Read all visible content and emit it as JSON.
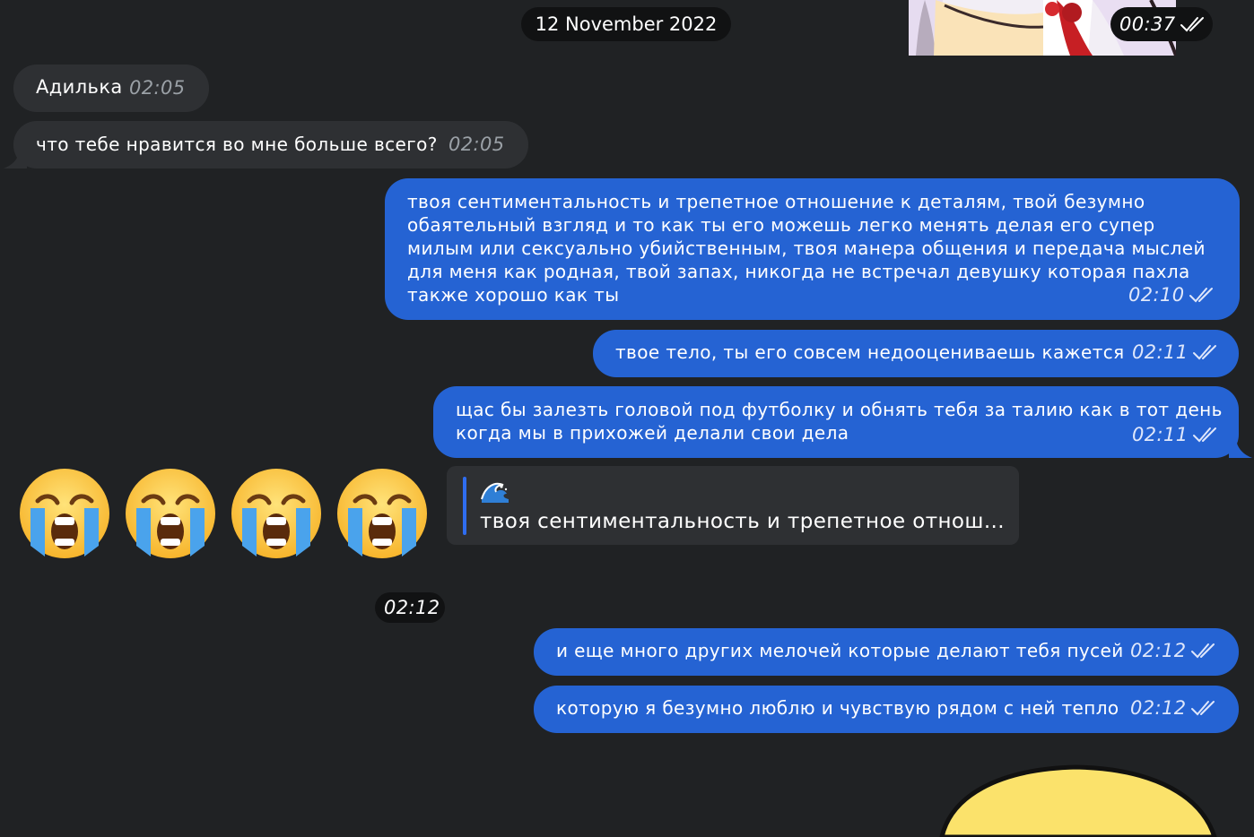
{
  "date_separator": "12 November 2022",
  "top_sticker_time": "00:37",
  "incoming": [
    {
      "text": "Адилька",
      "time": "02:05"
    },
    {
      "text": "что тебе нравится во мне больше всего?",
      "time": "02:05"
    }
  ],
  "outgoing": [
    {
      "lines": [
        "твоя сентиментальность и трепетное отношение к деталям, твой безумно",
        "обаятельный взгляд и то как ты его можешь легко менять делая его супер",
        "милым или сексуально убийственным, твоя манера общения и передача мыслей",
        "для меня как родная, твой запах, никогда не встречал девушку которая пахла",
        "также хорошо как ты"
      ],
      "time": "02:10"
    },
    {
      "lines": [
        "твое тело, ты его совсем недооцениваешь кажется"
      ],
      "time": "02:11"
    },
    {
      "lines": [
        "щас бы залезть головой под футболку и обнять тебя за талию как в тот день",
        "когда мы в прихожей делали свои дела"
      ],
      "time": "02:11"
    },
    {
      "lines": [
        "и еще много других мелочей которые делают тебя пусей"
      ],
      "time": "02:12"
    },
    {
      "lines": [
        "которую я безумно люблю и чувствую рядом с ней тепло"
      ],
      "time": "02:12"
    }
  ],
  "emoji_message": {
    "icons": [
      "loudly-crying-face-icon",
      "loudly-crying-face-icon",
      "loudly-crying-face-icon",
      "loudly-crying-face-icon"
    ],
    "time": "02:12",
    "reply": {
      "icon": "water-wave-icon",
      "quote": "твоя сентиментальность и трепетное отнош..."
    }
  },
  "colors": {
    "background": "#202224",
    "incoming_bubble": "#2e3033",
    "outgoing_bubble": "#2563d3",
    "pill": "#111213",
    "reply_accent": "#2f6df0"
  }
}
